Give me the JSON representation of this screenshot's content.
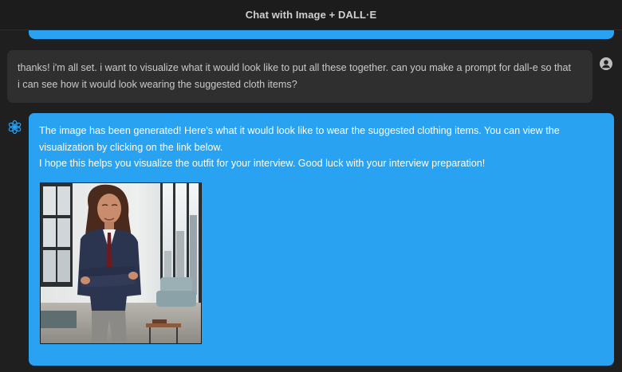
{
  "window": {
    "title": "Chat with Image + DALL·E"
  },
  "conversation": {
    "user_message": "thanks! i'm all set. i want to visualize what it would look like to put all these together. can you make a prompt for dall-e so that i can see how it would look wearing the suggested cloth items?",
    "assistant_message": {
      "line1": "The image has been generated! Here's what it would look like to wear the suggested clothing items. You can view the visualization by clicking on the link below.",
      "line2": "I hope this helps you visualize the outfit for your interview. Good luck with your interview preparation!"
    }
  },
  "icons": {
    "user_avatar": "user-avatar-icon",
    "assistant_avatar": "openai-logo-icon"
  },
  "colors": {
    "assistant_bubble": "#2aa2f2",
    "user_bubble": "#2f2f2f",
    "background": "#1f1f1f"
  }
}
